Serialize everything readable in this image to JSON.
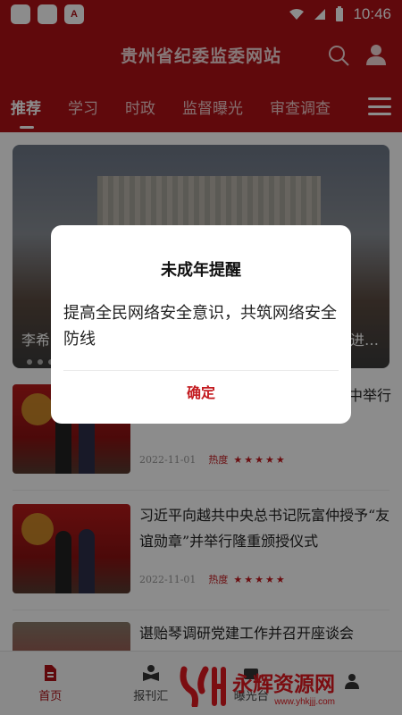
{
  "status_bar": {
    "app_icon_label": "A",
    "time": "10:46"
  },
  "header": {
    "title": "贵州省纪委监委网站",
    "search_icon": "search-icon",
    "user_icon": "user-icon"
  },
  "tabs": [
    {
      "label": "推荐",
      "active": true
    },
    {
      "label": "学习"
    },
    {
      "label": "时政"
    },
    {
      "label": "监督曝光"
    },
    {
      "label": "审查调查"
    }
  ],
  "banner": {
    "caption_left": "李希",
    "caption_right": "进…"
  },
  "news": [
    {
      "title": "中举行",
      "date": "2022-11-01",
      "heat_label": "热度",
      "stars": "★★★★★"
    },
    {
      "title": "习近平向越共中央总书记阮富仲授予“友谊勋章”并举行隆重颁授仪式",
      "date": "2022-11-01",
      "heat_label": "热度",
      "stars": "★★★★★"
    },
    {
      "title": "谌贻琴调研党建工作并召开座谈会"
    }
  ],
  "bottom_nav": [
    {
      "label": "首页",
      "icon": "home-icon",
      "active": true
    },
    {
      "label": "报刊汇",
      "icon": "book-icon"
    },
    {
      "label": "曝光台",
      "icon": "camera-icon"
    },
    {
      "label": "",
      "icon": "mine-icon"
    }
  ],
  "watermark": {
    "text": "永辉资源网",
    "url": "www.yhkjjj.com"
  },
  "dialog": {
    "title": "未成年提醒",
    "message": "提高全民网络安全意识，共筑网络安全防线",
    "confirm_label": "确定"
  },
  "colors": {
    "brand_red": "#b01117",
    "accent_red": "#c31a1f"
  }
}
